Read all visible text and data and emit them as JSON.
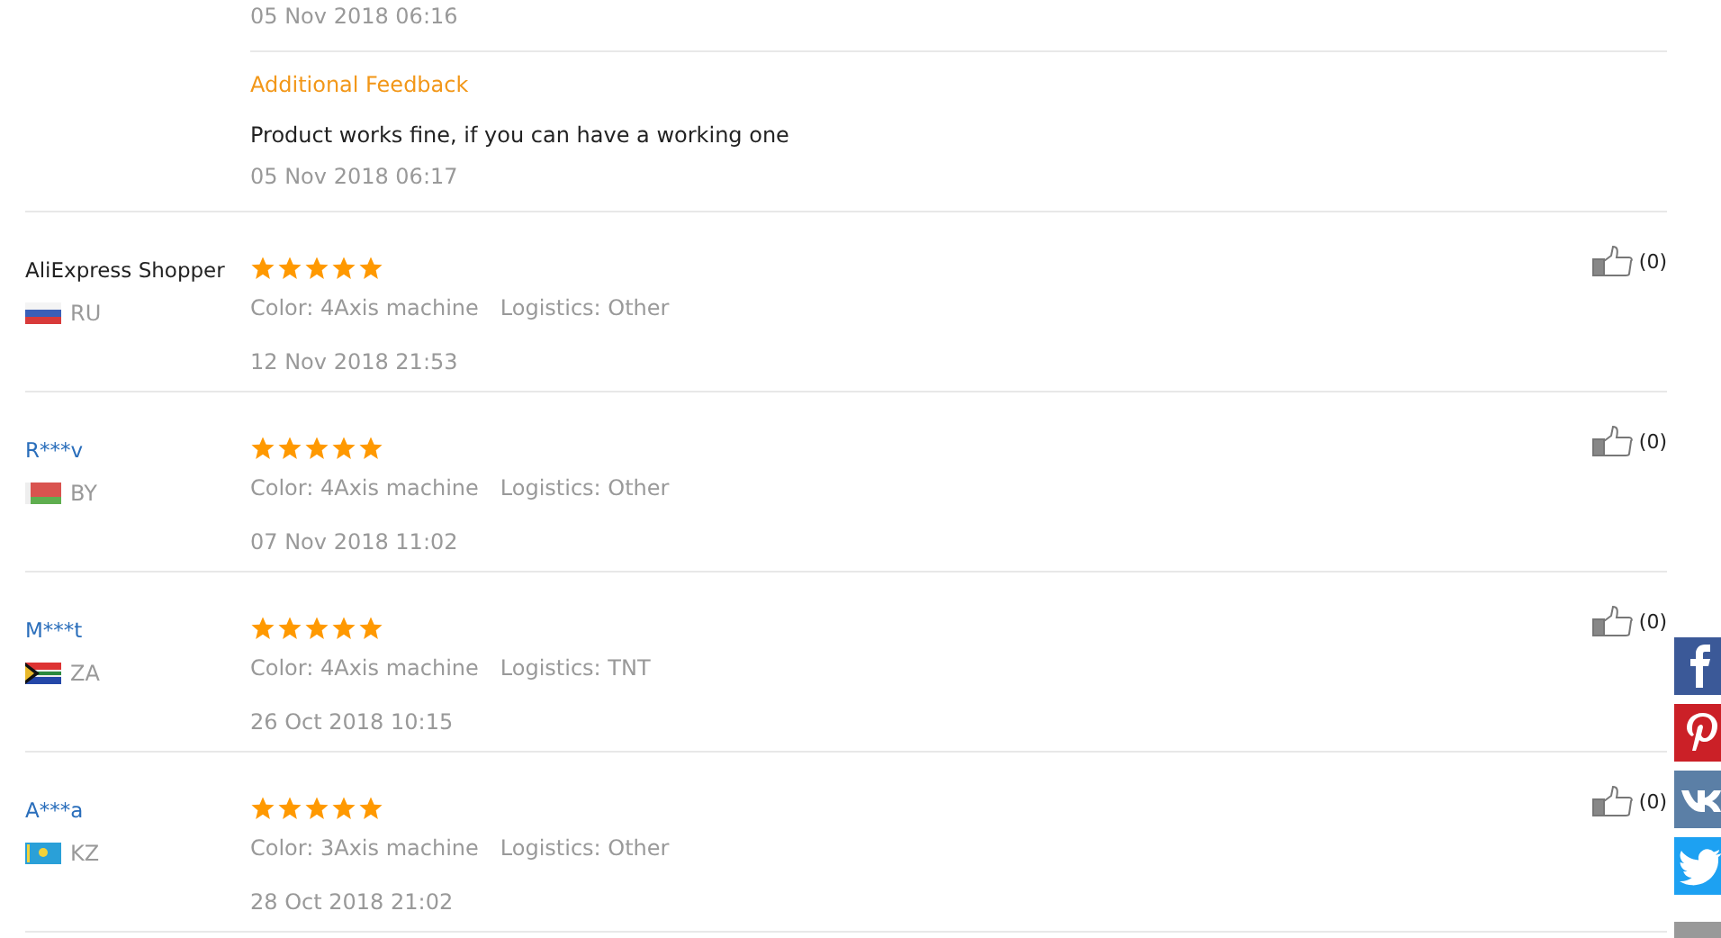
{
  "previous_review": {
    "date": "05 Nov 2018 06:16",
    "additional_feedback": {
      "heading": "Additional Feedback",
      "text": "Product works fine, if you can have a working one",
      "date": "05 Nov 2018 06:17"
    }
  },
  "reviews": [
    {
      "name": "AliExpress Shopper",
      "link": false,
      "country": {
        "code": "RU",
        "kind": "ru"
      },
      "stars": 5,
      "option": "Color: 4Axis machine",
      "logistics": "Logistics: Other",
      "date": "12 Nov 2018 21:53",
      "helpful": "(0)"
    },
    {
      "name": "R***v",
      "link": true,
      "country": {
        "code": "BY",
        "kind": "by"
      },
      "stars": 5,
      "option": "Color: 4Axis machine",
      "logistics": "Logistics: Other",
      "date": "07 Nov 2018 11:02",
      "helpful": "(0)"
    },
    {
      "name": "M***t",
      "link": true,
      "country": {
        "code": "ZA",
        "kind": "za"
      },
      "stars": 5,
      "option": "Color: 4Axis machine",
      "logistics": "Logistics: TNT",
      "date": "26 Oct 2018 10:15",
      "helpful": "(0)"
    },
    {
      "name": "A***a",
      "link": true,
      "country": {
        "code": "KZ",
        "kind": "kz"
      },
      "stars": 5,
      "option": "Color: 3Axis machine",
      "logistics": "Logistics: Other",
      "date": "28 Oct 2018 21:02",
      "helpful": "(0)"
    }
  ],
  "share_bar": [
    {
      "kind": "facebook"
    },
    {
      "kind": "pinterest"
    },
    {
      "kind": "vk"
    },
    {
      "kind": "twitter"
    },
    {
      "kind": "more"
    }
  ]
}
